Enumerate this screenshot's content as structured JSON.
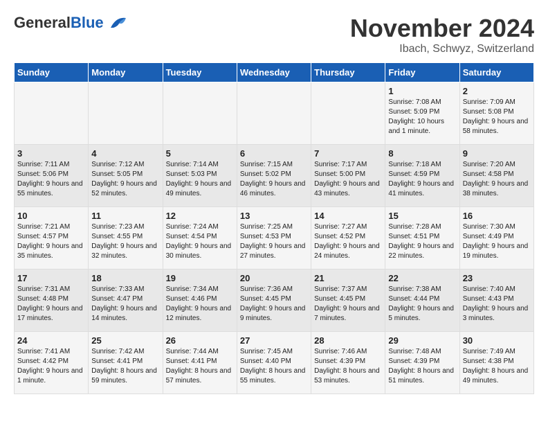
{
  "header": {
    "logo_general": "General",
    "logo_blue": "Blue",
    "month_title": "November 2024",
    "location": "Ibach, Schwyz, Switzerland"
  },
  "days_of_week": [
    "Sunday",
    "Monday",
    "Tuesday",
    "Wednesday",
    "Thursday",
    "Friday",
    "Saturday"
  ],
  "weeks": [
    [
      {
        "day": "",
        "info": ""
      },
      {
        "day": "",
        "info": ""
      },
      {
        "day": "",
        "info": ""
      },
      {
        "day": "",
        "info": ""
      },
      {
        "day": "",
        "info": ""
      },
      {
        "day": "1",
        "info": "Sunrise: 7:08 AM\nSunset: 5:09 PM\nDaylight: 10 hours and 1 minute."
      },
      {
        "day": "2",
        "info": "Sunrise: 7:09 AM\nSunset: 5:08 PM\nDaylight: 9 hours and 58 minutes."
      }
    ],
    [
      {
        "day": "3",
        "info": "Sunrise: 7:11 AM\nSunset: 5:06 PM\nDaylight: 9 hours and 55 minutes."
      },
      {
        "day": "4",
        "info": "Sunrise: 7:12 AM\nSunset: 5:05 PM\nDaylight: 9 hours and 52 minutes."
      },
      {
        "day": "5",
        "info": "Sunrise: 7:14 AM\nSunset: 5:03 PM\nDaylight: 9 hours and 49 minutes."
      },
      {
        "day": "6",
        "info": "Sunrise: 7:15 AM\nSunset: 5:02 PM\nDaylight: 9 hours and 46 minutes."
      },
      {
        "day": "7",
        "info": "Sunrise: 7:17 AM\nSunset: 5:00 PM\nDaylight: 9 hours and 43 minutes."
      },
      {
        "day": "8",
        "info": "Sunrise: 7:18 AM\nSunset: 4:59 PM\nDaylight: 9 hours and 41 minutes."
      },
      {
        "day": "9",
        "info": "Sunrise: 7:20 AM\nSunset: 4:58 PM\nDaylight: 9 hours and 38 minutes."
      }
    ],
    [
      {
        "day": "10",
        "info": "Sunrise: 7:21 AM\nSunset: 4:57 PM\nDaylight: 9 hours and 35 minutes."
      },
      {
        "day": "11",
        "info": "Sunrise: 7:23 AM\nSunset: 4:55 PM\nDaylight: 9 hours and 32 minutes."
      },
      {
        "day": "12",
        "info": "Sunrise: 7:24 AM\nSunset: 4:54 PM\nDaylight: 9 hours and 30 minutes."
      },
      {
        "day": "13",
        "info": "Sunrise: 7:25 AM\nSunset: 4:53 PM\nDaylight: 9 hours and 27 minutes."
      },
      {
        "day": "14",
        "info": "Sunrise: 7:27 AM\nSunset: 4:52 PM\nDaylight: 9 hours and 24 minutes."
      },
      {
        "day": "15",
        "info": "Sunrise: 7:28 AM\nSunset: 4:51 PM\nDaylight: 9 hours and 22 minutes."
      },
      {
        "day": "16",
        "info": "Sunrise: 7:30 AM\nSunset: 4:49 PM\nDaylight: 9 hours and 19 minutes."
      }
    ],
    [
      {
        "day": "17",
        "info": "Sunrise: 7:31 AM\nSunset: 4:48 PM\nDaylight: 9 hours and 17 minutes."
      },
      {
        "day": "18",
        "info": "Sunrise: 7:33 AM\nSunset: 4:47 PM\nDaylight: 9 hours and 14 minutes."
      },
      {
        "day": "19",
        "info": "Sunrise: 7:34 AM\nSunset: 4:46 PM\nDaylight: 9 hours and 12 minutes."
      },
      {
        "day": "20",
        "info": "Sunrise: 7:36 AM\nSunset: 4:45 PM\nDaylight: 9 hours and 9 minutes."
      },
      {
        "day": "21",
        "info": "Sunrise: 7:37 AM\nSunset: 4:45 PM\nDaylight: 9 hours and 7 minutes."
      },
      {
        "day": "22",
        "info": "Sunrise: 7:38 AM\nSunset: 4:44 PM\nDaylight: 9 hours and 5 minutes."
      },
      {
        "day": "23",
        "info": "Sunrise: 7:40 AM\nSunset: 4:43 PM\nDaylight: 9 hours and 3 minutes."
      }
    ],
    [
      {
        "day": "24",
        "info": "Sunrise: 7:41 AM\nSunset: 4:42 PM\nDaylight: 9 hours and 1 minute."
      },
      {
        "day": "25",
        "info": "Sunrise: 7:42 AM\nSunset: 4:41 PM\nDaylight: 8 hours and 59 minutes."
      },
      {
        "day": "26",
        "info": "Sunrise: 7:44 AM\nSunset: 4:41 PM\nDaylight: 8 hours and 57 minutes."
      },
      {
        "day": "27",
        "info": "Sunrise: 7:45 AM\nSunset: 4:40 PM\nDaylight: 8 hours and 55 minutes."
      },
      {
        "day": "28",
        "info": "Sunrise: 7:46 AM\nSunset: 4:39 PM\nDaylight: 8 hours and 53 minutes."
      },
      {
        "day": "29",
        "info": "Sunrise: 7:48 AM\nSunset: 4:39 PM\nDaylight: 8 hours and 51 minutes."
      },
      {
        "day": "30",
        "info": "Sunrise: 7:49 AM\nSunset: 4:38 PM\nDaylight: 8 hours and 49 minutes."
      }
    ]
  ]
}
